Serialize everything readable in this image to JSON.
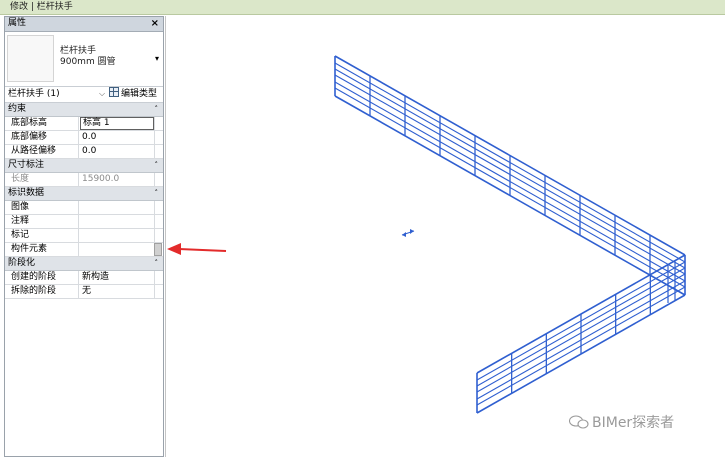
{
  "titlebar": {
    "text": "修改 | 栏杆扶手"
  },
  "properties_panel": {
    "header": "属性",
    "close_glyph": "×",
    "type_selector": {
      "family": "栏杆扶手",
      "type": "900mm 圆管",
      "dropdown_glyph": "▾"
    },
    "instance_filter": "栏杆扶手 (1)",
    "instance_dropdown_glyph": "⌵",
    "edit_type_label": "编辑类型",
    "collapse_glyph": "˄",
    "groups": [
      {
        "title": "约束",
        "rows": [
          {
            "name": "底部标高",
            "value": "标高 1"
          },
          {
            "name": "底部偏移",
            "value": "0.0"
          },
          {
            "name": "从路径偏移",
            "value": "0.0"
          }
        ]
      },
      {
        "title": "尺寸标注",
        "rows": [
          {
            "name": "长度",
            "value": "15900.0"
          }
        ]
      },
      {
        "title": "标识数据",
        "rows": [
          {
            "name": "图像",
            "value": ""
          },
          {
            "name": "注释",
            "value": ""
          },
          {
            "name": "标记",
            "value": ""
          },
          {
            "name": "构件元素",
            "value": ""
          }
        ]
      },
      {
        "title": "阶段化",
        "rows": [
          {
            "name": "创建的阶段",
            "value": "新构造"
          },
          {
            "name": "拆除的阶段",
            "value": "无"
          }
        ]
      }
    ]
  },
  "watermark": {
    "text": "BIMer探索者"
  },
  "colors": {
    "rail": "#2f5fd0",
    "arrow": "#e32b2b",
    "titlebar_bg": "#dbe7c9",
    "panel_header_bg": "#cfd6de"
  },
  "icons": {
    "close": "close-icon",
    "edit_type": "edit-type-icon",
    "dropdown": "chevron-down-icon",
    "collapse": "chevron-up-icon",
    "watermark": "wechat-icon"
  }
}
